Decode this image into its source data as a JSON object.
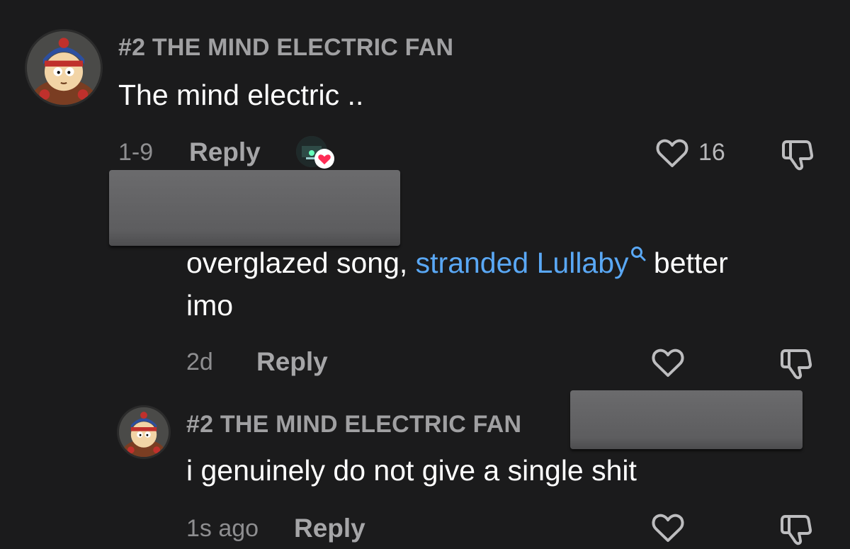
{
  "comment_1": {
    "username": "#2 THE MIND ELECTRIC FAN",
    "text": "The mind electric ..",
    "date": "1-9",
    "reply_label": "Reply",
    "like_count": "16"
  },
  "comment_2": {
    "text_part1": "overglazed song, ",
    "link_text": "stranded Lullaby",
    "text_part2": " better",
    "text_line2": "imo",
    "date": "2d",
    "reply_label": "Reply"
  },
  "comment_3": {
    "username": "#2 THE MIND ELECTRIC FAN",
    "text": "i genuinely do not give a single shit",
    "date": "1s ago",
    "reply_label": "Reply"
  },
  "icons": {
    "like": "heart-outline-icon",
    "dislike": "thumbs-down-outline-icon",
    "creator_like": "creator-liked-heart-icon",
    "link_search": "search-icon"
  },
  "colors": {
    "background": "#1b1b1c",
    "link": "#5aa8f5",
    "heart_red": "#fe2c55",
    "username": "#a0a0a2"
  }
}
